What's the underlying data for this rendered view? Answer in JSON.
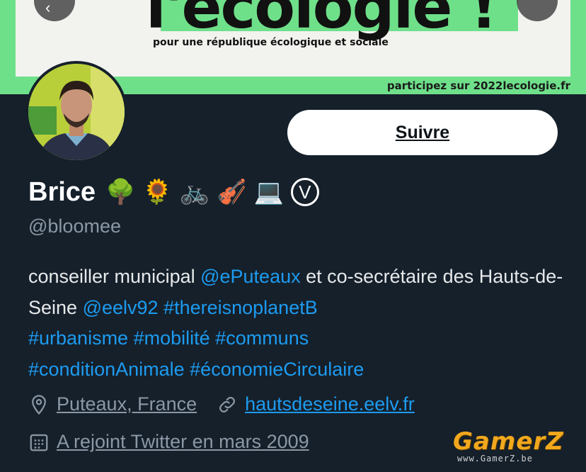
{
  "banner": {
    "headline": "l'écologie !",
    "subtitle": "pour une république écologique et sociale",
    "cta": "participez sur 2022lecologie.fr"
  },
  "header": {
    "back_icon": "arrow-left-icon",
    "more_icon": "more-icon"
  },
  "profile": {
    "follow_label": "Suivre",
    "name": "Brice",
    "name_emojis": [
      "🌳",
      "🌻",
      "🚲",
      "🎻",
      "💻"
    ],
    "badge": "V",
    "handle": "@bloomee",
    "bio": {
      "t1": "conseiller municipal ",
      "m1": "@ePuteaux",
      "t2": " et co-secrétaire des Hauts-de-Seine ",
      "m2": "@eelv92",
      "t3": " ",
      "h1": "#thereisnoplanetB",
      "t4": " ",
      "h2": "#urbanisme",
      "t5": " ",
      "h3": "#mobilité",
      "t6": " ",
      "h4": "#communs",
      "t7": " ",
      "h5": "#conditionAnimale",
      "t8": " ",
      "h6": "#économieCirculaire"
    },
    "location": "Puteaux, France",
    "website": "hautsdeseine.eelv.fr",
    "joined": "A rejoint Twitter en mars 2009",
    "colors": {
      "background": "#15202b",
      "link": "#1d9bf0",
      "muted": "#8b98a5",
      "banner_green": "#6fe08a"
    }
  },
  "watermark": {
    "title": "GamerZ",
    "url": "www.GamerZ.be"
  }
}
